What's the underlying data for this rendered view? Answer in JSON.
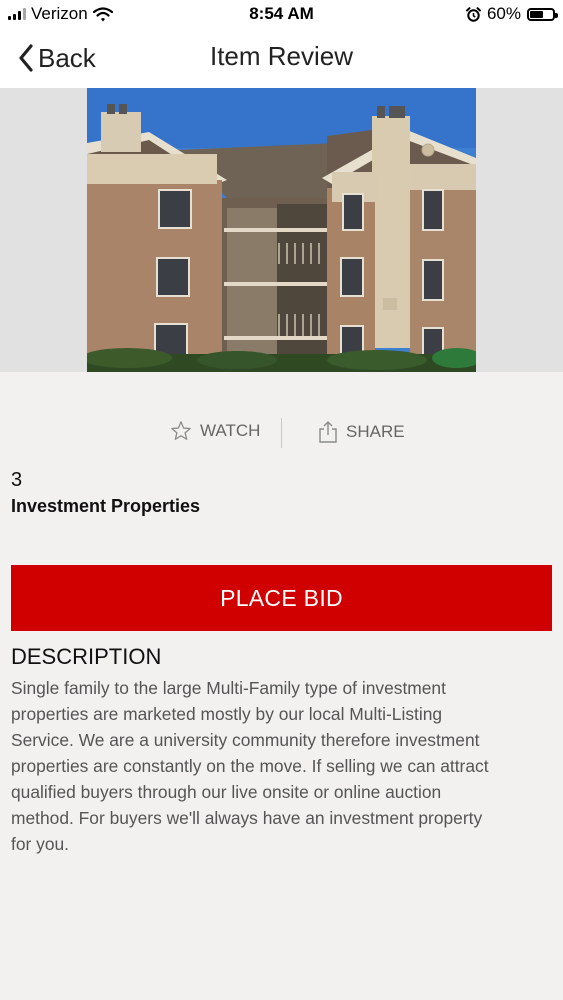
{
  "status_bar": {
    "carrier": "Verizon",
    "time": "8:54 AM",
    "battery_percent": "60%",
    "battery_level": 0.6,
    "icons": [
      "signal-icon",
      "wifi-icon",
      "alarm-icon",
      "battery-icon"
    ]
  },
  "nav": {
    "back_label": "Back",
    "title": "Item Review"
  },
  "hero": {
    "icon": "apartment-building-photo"
  },
  "actions": {
    "watch_label": "WATCH",
    "share_label": "SHARE",
    "watch_icon": "star-icon",
    "share_icon": "share-icon"
  },
  "item": {
    "number": "3",
    "title": "Investment Properties"
  },
  "bid": {
    "label": "PLACE BID",
    "color": "#d10000"
  },
  "description": {
    "heading": "DESCRIPTION",
    "body": "Single family to the large Multi-Family type of investment\nproperties are marketed mostly by our local Multi-Listing\nService.  We are a university community therefore investment\nproperties are constantly on the move.  If selling we can attract\nqualified buyers through our live onsite or online auction\nmethod.  For buyers we'll always have an investment property\nfor you."
  }
}
